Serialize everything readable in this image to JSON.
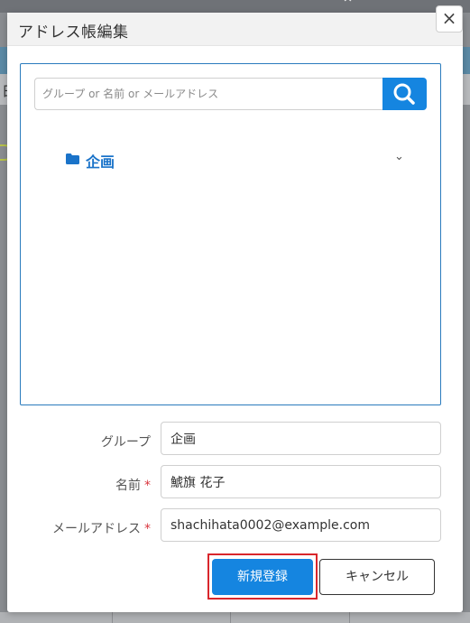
{
  "dialog": {
    "title": "アドレス帳編集",
    "close_label": "×"
  },
  "search": {
    "placeholder": "グループ or 名前 or メールアドレス",
    "icon": "search-icon"
  },
  "tree": {
    "groups": [
      {
        "label": "企画",
        "icon": "folder-icon",
        "expand_icon": "chevron-down-icon",
        "expand_glyph": "⌄"
      }
    ]
  },
  "form": {
    "group": {
      "label": "グループ",
      "value": "企画",
      "required": false
    },
    "name": {
      "label": "名前",
      "value": "鯱旗 花子",
      "required": true
    },
    "email": {
      "label": "メールアドレス",
      "value": "shachihata0002@example.com",
      "required": true
    },
    "required_mark": "*"
  },
  "buttons": {
    "register_label": "新規登録",
    "cancel_label": "キャンセル"
  },
  "background": {
    "fragment_text": "日",
    "chevron_glyph": "⌃"
  },
  "colors": {
    "primary": "#1585e0",
    "folder_text": "#1a73c9",
    "panel_border": "#2a7bbd",
    "required_mark": "#d9363e",
    "highlight": "#d9262c"
  }
}
